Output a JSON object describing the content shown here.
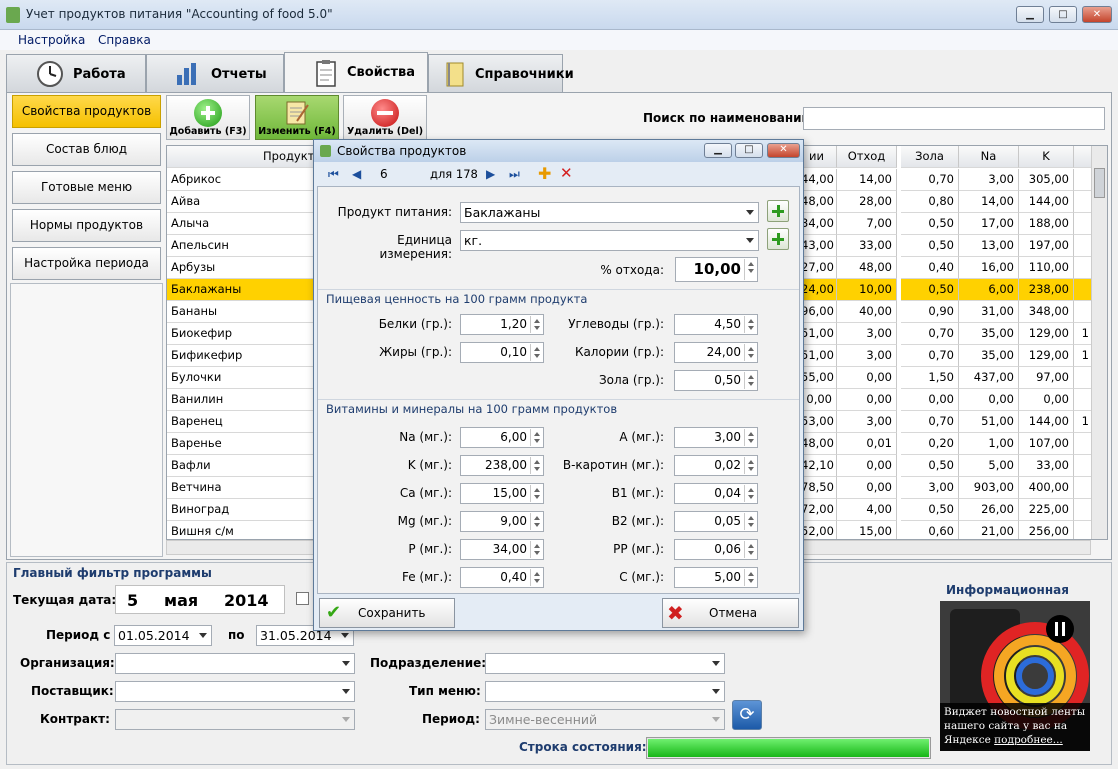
{
  "window": {
    "title": "Учет продуктов питания \"Accounting of food 5.0\""
  },
  "menu": [
    "Настройка",
    "Справка"
  ],
  "tabs": [
    {
      "label": "Работа",
      "icon": "clock-icon"
    },
    {
      "label": "Отчеты",
      "icon": "chart-icon"
    },
    {
      "label": "Свойства",
      "icon": "clipboard-icon"
    },
    {
      "label": "Справочники",
      "icon": "notebook-icon"
    }
  ],
  "active_tab": "Свойства",
  "left_menu": [
    "Свойства продуктов",
    "Состав блюд",
    "Готовые меню",
    "Нормы продуктов",
    "Настройка периода"
  ],
  "toolbar": {
    "add": "Добавить (F3)",
    "edit": "Изменить (F4)",
    "delete": "Удалить (Del)"
  },
  "search": {
    "label": "Поиск по наименованию:",
    "value": ""
  },
  "grid": {
    "headers": [
      "Продукт",
      "ии",
      "Отход",
      "Зола",
      "Na",
      "K",
      ""
    ],
    "rows": [
      {
        "name": "Абрикос",
        "c1": "44,00",
        "otkhod": "14,00",
        "zola": "0,70",
        "na": "3,00",
        "k": "305,00",
        "extra": ""
      },
      {
        "name": "Айва",
        "c1": "48,00",
        "otkhod": "28,00",
        "zola": "0,80",
        "na": "14,00",
        "k": "144,00",
        "extra": ""
      },
      {
        "name": "Алыча",
        "c1": "34,00",
        "otkhod": "7,00",
        "zola": "0,50",
        "na": "17,00",
        "k": "188,00",
        "extra": ""
      },
      {
        "name": "Апельсин",
        "c1": "43,00",
        "otkhod": "33,00",
        "zola": "0,50",
        "na": "13,00",
        "k": "197,00",
        "extra": ""
      },
      {
        "name": "Арбузы",
        "c1": "27,00",
        "otkhod": "48,00",
        "zola": "0,40",
        "na": "16,00",
        "k": "110,00",
        "extra": ""
      },
      {
        "name": "Баклажаны",
        "c1": "24,00",
        "otkhod": "10,00",
        "zola": "0,50",
        "na": "6,00",
        "k": "238,00",
        "extra": "",
        "selected": true
      },
      {
        "name": "Бананы",
        "c1": "96,00",
        "otkhod": "40,00",
        "zola": "0,90",
        "na": "31,00",
        "k": "348,00",
        "extra": ""
      },
      {
        "name": "Биокефир",
        "c1": "51,00",
        "otkhod": "3,00",
        "zola": "0,70",
        "na": "35,00",
        "k": "129,00",
        "extra": "1"
      },
      {
        "name": "Бификефир",
        "c1": "51,00",
        "otkhod": "3,00",
        "zola": "0,70",
        "na": "35,00",
        "k": "129,00",
        "extra": "1"
      },
      {
        "name": "Булочки",
        "c1": "55,00",
        "otkhod": "0,00",
        "zola": "1,50",
        "na": "437,00",
        "k": "97,00",
        "extra": ""
      },
      {
        "name": "Ванилин",
        "c1": "0,00",
        "otkhod": "0,00",
        "zola": "0,00",
        "na": "0,00",
        "k": "0,00",
        "extra": ""
      },
      {
        "name": "Варенец",
        "c1": "53,00",
        "otkhod": "3,00",
        "zola": "0,70",
        "na": "51,00",
        "k": "144,00",
        "extra": "1"
      },
      {
        "name": "Варенье",
        "c1": "48,00",
        "otkhod": "0,01",
        "zola": "0,20",
        "na": "1,00",
        "k": "107,00",
        "extra": ""
      },
      {
        "name": "Вафли",
        "c1": "42,10",
        "otkhod": "0,00",
        "zola": "0,50",
        "na": "5,00",
        "k": "33,00",
        "extra": ""
      },
      {
        "name": "Ветчина",
        "c1": "78,50",
        "otkhod": "0,00",
        "zola": "3,00",
        "na": "903,00",
        "k": "400,00",
        "extra": ""
      },
      {
        "name": "Виноград",
        "c1": "72,00",
        "otkhod": "4,00",
        "zola": "0,50",
        "na": "26,00",
        "k": "225,00",
        "extra": ""
      },
      {
        "name": "Вишня с/м",
        "c1": "52,00",
        "otkhod": "15,00",
        "zola": "0,60",
        "na": "21,00",
        "k": "256,00",
        "extra": ""
      }
    ]
  },
  "filter": {
    "title": "Главный фильтр программы",
    "current_date_label": "Текущая дата:",
    "day": "5",
    "month": "мая",
    "year": "2014",
    "period_label": "Период с",
    "period_from": "01.05.2014",
    "period_to_label": "по",
    "period_to": "31.05.2014",
    "org_label": "Организация:",
    "supplier_label": "Поставщик:",
    "contract_label": "Контракт:",
    "division_label": "Подразделение:",
    "menu_type_label": "Тип меню:",
    "period2_label": "Период:",
    "period2_value": "Зимне-весенний",
    "status_label": "Строка состояния:",
    "status_progress": 1.0
  },
  "info": {
    "title": "Информационная",
    "text": "Виджет новостной ленты нашего сайта у вас на Яндексе",
    "link": "подробнее..."
  },
  "dialog": {
    "title": "Свойства продуктов",
    "record": "6",
    "of_label": "для 178",
    "product_label": "Продукт питания:",
    "product_value": "Баклажаны",
    "unit_label": "Единица измерения:",
    "unit_value": "кг.",
    "waste_label": "% отхода:",
    "waste_value": "10,00",
    "section1": "Пищевая ценность на 100 грамм продукта",
    "section2": "Витамины и минералы на 100 грамм продуктов",
    "nutrition": [
      {
        "label": "Белки (гр.):",
        "value": "1,20"
      },
      {
        "label": "Жиры (гр.):",
        "value": "0,10"
      },
      {
        "label": "Углеводы (гр.):",
        "value": "4,50"
      },
      {
        "label": "Калории (гр.):",
        "value": "24,00"
      },
      {
        "label": "Зола (гр.):",
        "value": "0,50"
      }
    ],
    "minerals_left": [
      {
        "label": "Na (мг.):",
        "value": "6,00"
      },
      {
        "label": "K (мг.):",
        "value": "238,00"
      },
      {
        "label": "Ca (мг.):",
        "value": "15,00"
      },
      {
        "label": "Mg (мг.):",
        "value": "9,00"
      },
      {
        "label": "P (мг.):",
        "value": "34,00"
      },
      {
        "label": "Fe (мг.):",
        "value": "0,40"
      }
    ],
    "minerals_right": [
      {
        "label": "A (мг.):",
        "value": "3,00"
      },
      {
        "label": "В-каротин (мг.):",
        "value": "0,02"
      },
      {
        "label": "B1 (мг.):",
        "value": "0,04"
      },
      {
        "label": "B2 (мг.):",
        "value": "0,05"
      },
      {
        "label": "PP (мг.):",
        "value": "0,06"
      },
      {
        "label": "C (мг.):",
        "value": "5,00"
      }
    ],
    "save": "Сохранить",
    "cancel": "Отмена"
  }
}
